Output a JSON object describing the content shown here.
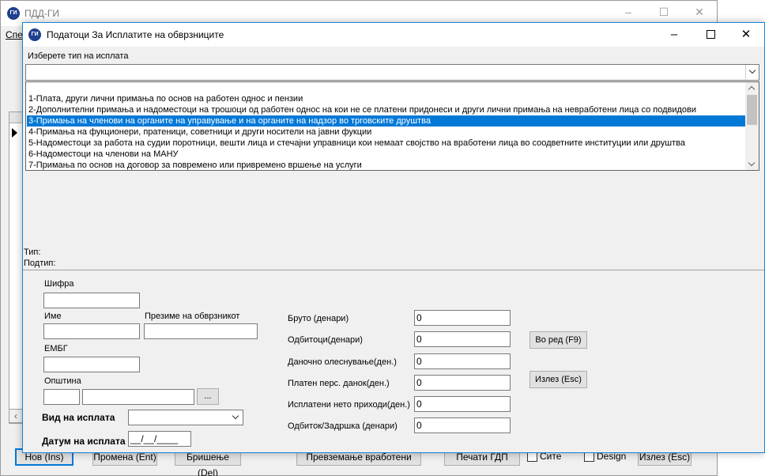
{
  "bg_window": {
    "title": "ПДД-ГИ",
    "menu_label": "Спе",
    "icon_text": "ГИ",
    "buttons": [
      {
        "label": "Нов (Ins)"
      },
      {
        "label": "Промена (Ent)"
      },
      {
        "label": "Бришење (Del)"
      },
      {
        "label": "Превземање вработени"
      },
      {
        "label": "Печати ГДП"
      },
      {
        "label": "Излез (Esc)"
      }
    ],
    "checkboxes": [
      {
        "label": "Сите"
      },
      {
        "label": "Design"
      }
    ]
  },
  "dialog": {
    "title": "Податоци  За Исплатите на обврзниците",
    "icon_text": "ГИ",
    "payment_type_prompt": "Изберете тип на исплата",
    "payment_type_value": "",
    "payment_types": [
      "1-Плата, други лични примања по основ на работен однос и пензии",
      "2-Дополнителни примања и надоместоци на трошоци од работен однос  на кои не се платени придонеси и други лични примања на невработени лица  со подвидови",
      "3-Примања на членови на органите на управување и на органите на надзор во трговските друштва",
      "4-Примања на фукционери, пратеници, советници и други носители  на јавни фукции",
      "5-Надоместоци за работа на  судии поротници, вешти лица и  стечајни управници кои немаат  својство на вработени лица  во соодветните институции или  друштва",
      "6-Надоместоци на членови на  МАНУ",
      "7-Примања по основ на договор за повремено или привремено вршење на услуги"
    ],
    "selected_index": 2,
    "type_label": "Тип:",
    "subtype_label": "Подтип:",
    "form": {
      "sifra_label": "Шифра",
      "sifra_value": "",
      "ime_label": "Име",
      "ime_value": "",
      "prezime_label": "Презиме на обврзникот",
      "prezime_value": "",
      "embg_label": "ЕМБГ",
      "embg_value": "",
      "opstina_label": "Општина",
      "opstina_code": "",
      "opstina_name": "",
      "opstina_browse": "...",
      "vid_label": "Вид на исплата",
      "vid_value": "",
      "datum_label": "Датум на исплата",
      "datum_value": "__/__/____"
    },
    "amounts": [
      {
        "label": "Бруто (денари)",
        "value": "0"
      },
      {
        "label": "Одбитоци(денари)",
        "value": "0"
      },
      {
        "label": "Даночно олеснување(ден.)",
        "value": "0"
      },
      {
        "label": "Платен перс.  данок(ден.)",
        "value": "0"
      },
      {
        "label": "Исплатени нето приходи(ден.)",
        "value": "0"
      },
      {
        "label": "Одбиток/Задршка (денари)",
        "value": "0"
      }
    ],
    "ok_button": "Во ред (F9)",
    "exit_button": "Излез (Esc)"
  }
}
